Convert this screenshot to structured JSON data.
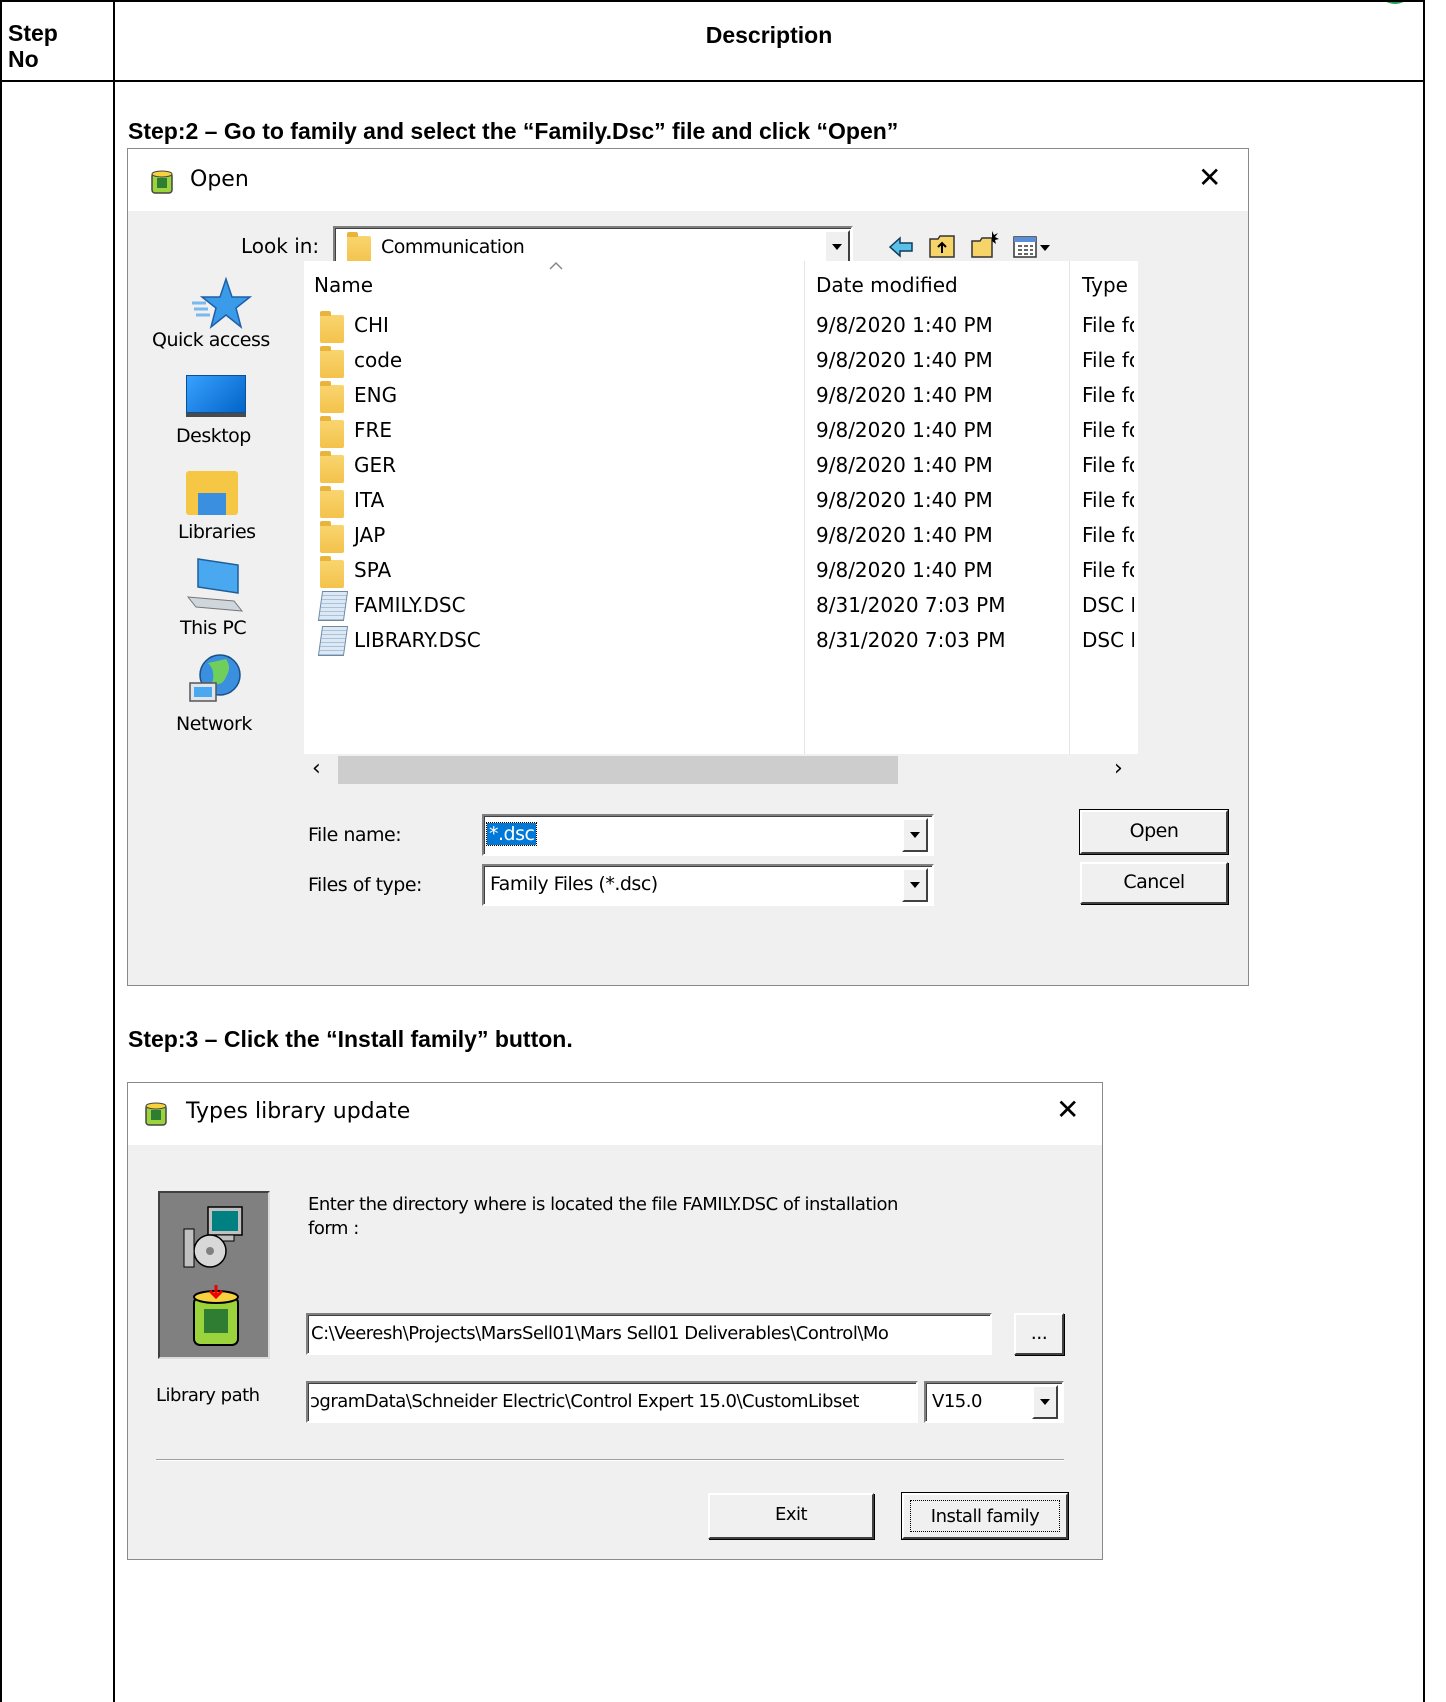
{
  "table": {
    "header_step": "Step No",
    "header_step_line1": "Step",
    "header_step_line2": "No",
    "header_description": "Description"
  },
  "steps": {
    "step2_text": "Step:2 – Go to family and select the “Family.Dsc” file and click “Open”",
    "step3_text": "Step:3 – Click the “Install family” button."
  },
  "open_dialog": {
    "title": "Open",
    "look_in_label": "Look in:",
    "look_in_value": "Communication",
    "places": [
      "Quick access",
      "Desktop",
      "Libraries",
      "This PC",
      "Network"
    ],
    "columns": {
      "name": "Name",
      "date": "Date modified",
      "type": "Type"
    },
    "files": [
      {
        "name": "CHI",
        "date": "9/8/2020 1:40 PM",
        "type": "File fc",
        "kind": "folder"
      },
      {
        "name": "code",
        "date": "9/8/2020 1:40 PM",
        "type": "File fc",
        "kind": "folder"
      },
      {
        "name": "ENG",
        "date": "9/8/2020 1:40 PM",
        "type": "File fc",
        "kind": "folder"
      },
      {
        "name": "FRE",
        "date": "9/8/2020 1:40 PM",
        "type": "File fc",
        "kind": "folder"
      },
      {
        "name": "GER",
        "date": "9/8/2020 1:40 PM",
        "type": "File fc",
        "kind": "folder"
      },
      {
        "name": "ITA",
        "date": "9/8/2020 1:40 PM",
        "type": "File fc",
        "kind": "folder"
      },
      {
        "name": "JAP",
        "date": "9/8/2020 1:40 PM",
        "type": "File fc",
        "kind": "folder"
      },
      {
        "name": "SPA",
        "date": "9/8/2020 1:40 PM",
        "type": "File fc",
        "kind": "folder"
      },
      {
        "name": "FAMILY.DSC",
        "date": "8/31/2020 7:03 PM",
        "type": "DSC F",
        "kind": "file"
      },
      {
        "name": "LIBRARY.DSC",
        "date": "8/31/2020 7:03 PM",
        "type": "DSC F",
        "kind": "file"
      }
    ],
    "file_name_label": "File name:",
    "file_name_value": "*.dsc",
    "files_of_type_label": "Files of type:",
    "files_of_type_value": "Family Files (*.dsc)",
    "open_button": "Open",
    "cancel_button": "Cancel",
    "scroll_left": "‹",
    "scroll_right": "›"
  },
  "types_dialog": {
    "title": "Types library update",
    "instruction": "Enter the directory where is located the file FAMILY.DSC of installation form :",
    "instruction_line1": "Enter the directory where is located the file FAMILY.DSC of installation",
    "instruction_line2": "form :",
    "directory_value": "C:\\Veeresh\\Projects\\MarsSell01\\Mars Sell01 Deliverables\\Control\\Mo",
    "browse_button": "...",
    "library_path_label": "Library path",
    "library_path_value": "ɔgramData\\Schneider Electric\\Control Expert 15.0\\CustomLibset",
    "version_value": "V15.0",
    "exit_button": "Exit",
    "install_button": "Install family"
  },
  "colors": {
    "window_bg": "#f0f0f0",
    "selection": "#0078d7",
    "accent_green": "#1fa14a"
  }
}
